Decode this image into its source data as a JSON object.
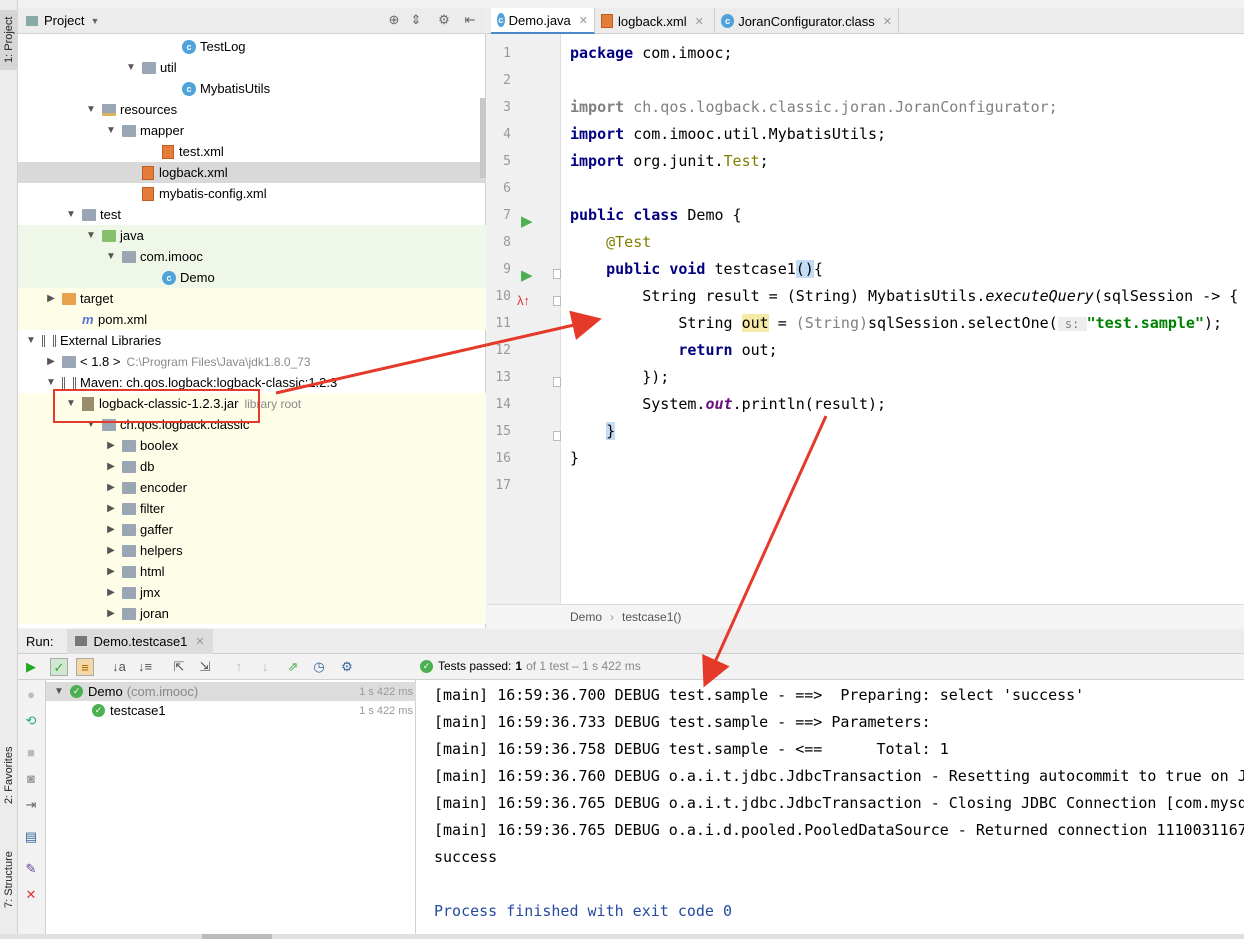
{
  "sidebar": {
    "project_tab": "1: Project",
    "favorites_tab": "2: Favorites",
    "structure_tab": "7: Structure"
  },
  "project": {
    "title": "Project",
    "tree": [
      {
        "label": "TestLog",
        "icon": "class-icon",
        "indent": 7
      },
      {
        "label": "util",
        "icon": "folder-icon",
        "indent": 5,
        "expanded": true
      },
      {
        "label": "MybatisUtils",
        "icon": "class-icon",
        "indent": 7
      },
      {
        "label": "resources",
        "icon": "resources-folder-icon",
        "indent": 3,
        "expanded": true
      },
      {
        "label": "mapper",
        "icon": "folder-icon",
        "indent": 4,
        "expanded": true
      },
      {
        "label": "test.xml",
        "icon": "xml-icon",
        "indent": 6
      },
      {
        "label": "logback.xml",
        "icon": "xml-icon",
        "indent": 5,
        "selected": true
      },
      {
        "label": "mybatis-config.xml",
        "icon": "xml-icon",
        "indent": 5
      },
      {
        "label": "test",
        "icon": "folder-icon",
        "indent": 2,
        "expanded": true
      },
      {
        "label": "java",
        "icon": "test-source-folder-icon",
        "indent": 3,
        "expanded": true
      },
      {
        "label": "com.imooc",
        "icon": "package-icon",
        "indent": 4,
        "expanded": true
      },
      {
        "label": "Demo",
        "icon": "class-icon",
        "indent": 6
      },
      {
        "label": "target",
        "icon": "target-folder-icon",
        "indent": 1,
        "collapsed": true
      },
      {
        "label": "pom.xml",
        "icon": "maven-icon",
        "indent": 2
      },
      {
        "label": "External Libraries",
        "icon": "library-icon",
        "indent": 0,
        "expanded": true
      },
      {
        "label": "< 1.8 >",
        "suffix": "C:\\Program Files\\Java\\jdk1.8.0_73",
        "icon": "jdk-icon",
        "indent": 1,
        "collapsed": true
      },
      {
        "label": "Maven: ch.qos.logback:logback-classic:1.2.3",
        "icon": "library-icon",
        "indent": 1,
        "expanded": true
      },
      {
        "label": "logback-classic-1.2.3.jar",
        "suffix": "library root",
        "icon": "jar-icon",
        "indent": 2,
        "expanded": true
      },
      {
        "label": "ch.qos.logback.classic",
        "icon": "package-icon",
        "indent": 3,
        "expanded": true
      },
      {
        "label": "boolex",
        "icon": "package-icon",
        "indent": 4,
        "collapsed": true
      },
      {
        "label": "db",
        "icon": "package-icon",
        "indent": 4,
        "collapsed": true
      },
      {
        "label": "encoder",
        "icon": "package-icon",
        "indent": 4,
        "collapsed": true
      },
      {
        "label": "filter",
        "icon": "package-icon",
        "indent": 4,
        "collapsed": true
      },
      {
        "label": "gaffer",
        "icon": "package-icon",
        "indent": 4,
        "collapsed": true
      },
      {
        "label": "helpers",
        "icon": "package-icon",
        "indent": 4,
        "collapsed": true
      },
      {
        "label": "html",
        "icon": "package-icon",
        "indent": 4,
        "collapsed": true
      },
      {
        "label": "jmx",
        "icon": "package-icon",
        "indent": 4,
        "collapsed": true
      },
      {
        "label": "joran",
        "icon": "package-icon",
        "indent": 4,
        "collapsed": true
      }
    ]
  },
  "editor": {
    "tabs": [
      {
        "label": "Demo.java",
        "active": true
      },
      {
        "label": "logback.xml"
      },
      {
        "label": "JoranConfigurator.class"
      }
    ],
    "breadcrumb": [
      "Demo",
      "testcase1()"
    ],
    "line_numbers": [
      "1",
      "2",
      "3",
      "4",
      "5",
      "6",
      "7",
      "8",
      "9",
      "10",
      "11",
      "12",
      "13",
      "14",
      "15",
      "16",
      "17"
    ]
  },
  "run": {
    "label": "Run:",
    "config_tab": "Demo.testcase1",
    "status_prefix": "Tests passed:",
    "status_count": "1",
    "status_suffix": "of 1 test – 1 s 422 ms",
    "tree": [
      {
        "label": "Demo",
        "sub": "(com.imooc)",
        "time": "1 s 422 ms"
      },
      {
        "label": "testcase1",
        "time": "1 s 422 ms"
      }
    ],
    "console": [
      "[main] 16:59:36.700 DEBUG test.sample - ==>  Preparing: select 'success'",
      "[main] 16:59:36.733 DEBUG test.sample - ==> Parameters: ",
      "[main] 16:59:36.758 DEBUG test.sample - <==      Total: 1",
      "[main] 16:59:36.760 DEBUG o.a.i.t.jdbc.JdbcTransaction - Resetting autocommit to true on J",
      "[main] 16:59:36.765 DEBUG o.a.i.t.jdbc.JdbcTransaction - Closing JDBC Connection [com.mysq",
      "[main] 16:59:36.765 DEBUG o.a.i.d.pooled.PooledDataSource - Returned connection 1110031167",
      "success",
      "",
      "Process finished with exit code 0"
    ]
  },
  "colors": {
    "annotation_arrow": "#e53a2a",
    "selected_row": "#dadada",
    "test_root_bg": "#eef7e8",
    "lib_bg": "#fdfde8"
  }
}
